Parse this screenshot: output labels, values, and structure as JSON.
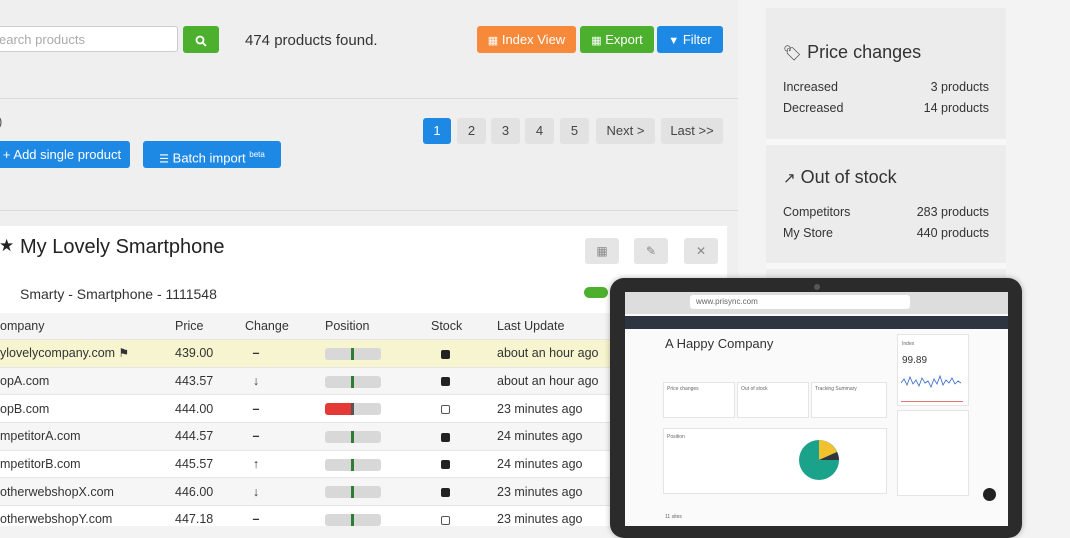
{
  "search": {
    "placeholder": "earch products",
    "button_icon": "search-icon"
  },
  "results": {
    "found_text": "474 products found."
  },
  "toolbar": {
    "index_view": "Index View",
    "export": "Export",
    "filter": "Filter"
  },
  "stray_text": ")",
  "pagination": {
    "pages": [
      "1",
      "2",
      "3",
      "4",
      "5"
    ],
    "next": "Next >",
    "last": "Last >>",
    "active": "1"
  },
  "actions": {
    "add_single": "Add single product",
    "batch_import": "Batch import",
    "beta": "beta"
  },
  "product": {
    "title": "My Lovely Smartphone",
    "subtitle": "Smarty - Smartphone - 1111548",
    "columns": [
      "ompany",
      "Price",
      "Change",
      "Position",
      "Stock",
      "Last Update"
    ],
    "rows": [
      {
        "company": "ylovelycompany.com",
        "flag": true,
        "price": "439.00",
        "change": "–",
        "position": 0.48,
        "pos_red": false,
        "stock": "in",
        "updated": "about an hour ago"
      },
      {
        "company": "opA.com",
        "flag": false,
        "price": "443.57",
        "change": "↓",
        "position": 0.48,
        "pos_red": false,
        "stock": "in",
        "updated": "about an hour ago"
      },
      {
        "company": "opB.com",
        "flag": false,
        "price": "444.00",
        "change": "–",
        "position": 0.48,
        "pos_red": true,
        "stock": "out",
        "updated": "23 minutes ago"
      },
      {
        "company": "mpetitorA.com",
        "flag": false,
        "price": "444.57",
        "change": "–",
        "position": 0.48,
        "pos_red": false,
        "stock": "in",
        "updated": "24 minutes ago"
      },
      {
        "company": "mpetitorB.com",
        "flag": false,
        "price": "445.57",
        "change": "↑",
        "position": 0.48,
        "pos_red": false,
        "stock": "in",
        "updated": "24 minutes ago"
      },
      {
        "company": "otherwebshopX.com",
        "flag": false,
        "price": "446.00",
        "change": "↓",
        "position": 0.48,
        "pos_red": false,
        "stock": "in",
        "updated": "23 minutes ago"
      },
      {
        "company": "otherwebshopY.com",
        "flag": false,
        "price": "447.18",
        "change": "–",
        "position": 0.48,
        "pos_red": false,
        "stock": "out",
        "updated": "23 minutes ago"
      }
    ]
  },
  "sidebar": {
    "price_changes": {
      "title": "Price changes",
      "rows": [
        {
          "label": "Increased",
          "value": "3 products"
        },
        {
          "label": "Decreased",
          "value": "14 products"
        }
      ]
    },
    "out_of_stock": {
      "title": "Out of stock",
      "rows": [
        {
          "label": "Competitors",
          "value": "283 products"
        },
        {
          "label": "My Store",
          "value": "440 products"
        }
      ]
    }
  },
  "laptop": {
    "url": "www.prisync.com",
    "company": "A Happy Company",
    "index_label": "Index",
    "index_value": "99.89",
    "sections": [
      "Price changes",
      "Out of stock",
      "Tracking Summary",
      "Position"
    ],
    "sites": "11 sites"
  },
  "colors": {
    "orange": "#f7893b",
    "green": "#4caf2d",
    "blue": "#1e88e5",
    "red": "#e53935"
  }
}
